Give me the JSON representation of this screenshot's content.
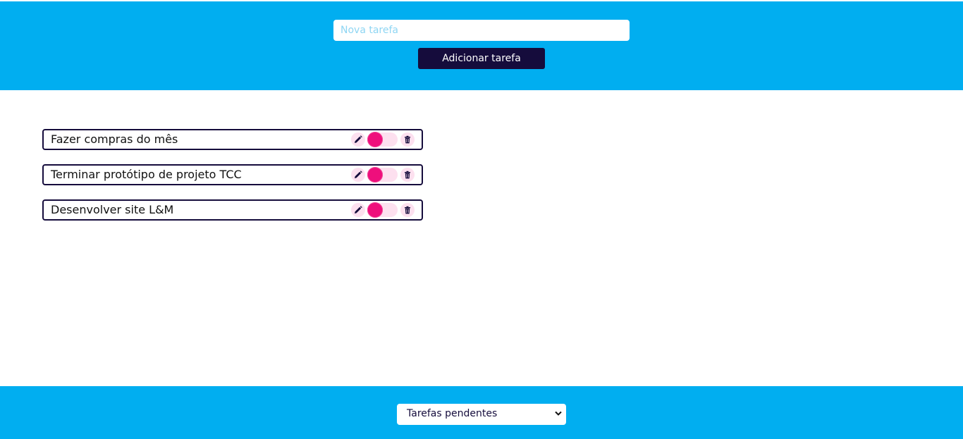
{
  "header": {
    "input_placeholder": "Nova tarefa",
    "input_value": "",
    "add_button_label": "Adicionar tarefa"
  },
  "tasks": [
    {
      "text": "Fazer compras do mês",
      "completed": false
    },
    {
      "text": "Terminar protótipo de projeto TCC",
      "completed": false
    },
    {
      "text": "Desenvolver site L&M",
      "completed": false
    }
  ],
  "icons": {
    "edit": "pencil-icon",
    "toggle": "toggle-switch",
    "delete": "trash-icon"
  },
  "footer": {
    "filter_selected": "Tarefas pendentes"
  },
  "colors": {
    "header_bg": "#01aef0",
    "button_bg": "#150c3c",
    "accent_pink": "#ee0f7c",
    "pill_bg": "#fde0ef"
  }
}
